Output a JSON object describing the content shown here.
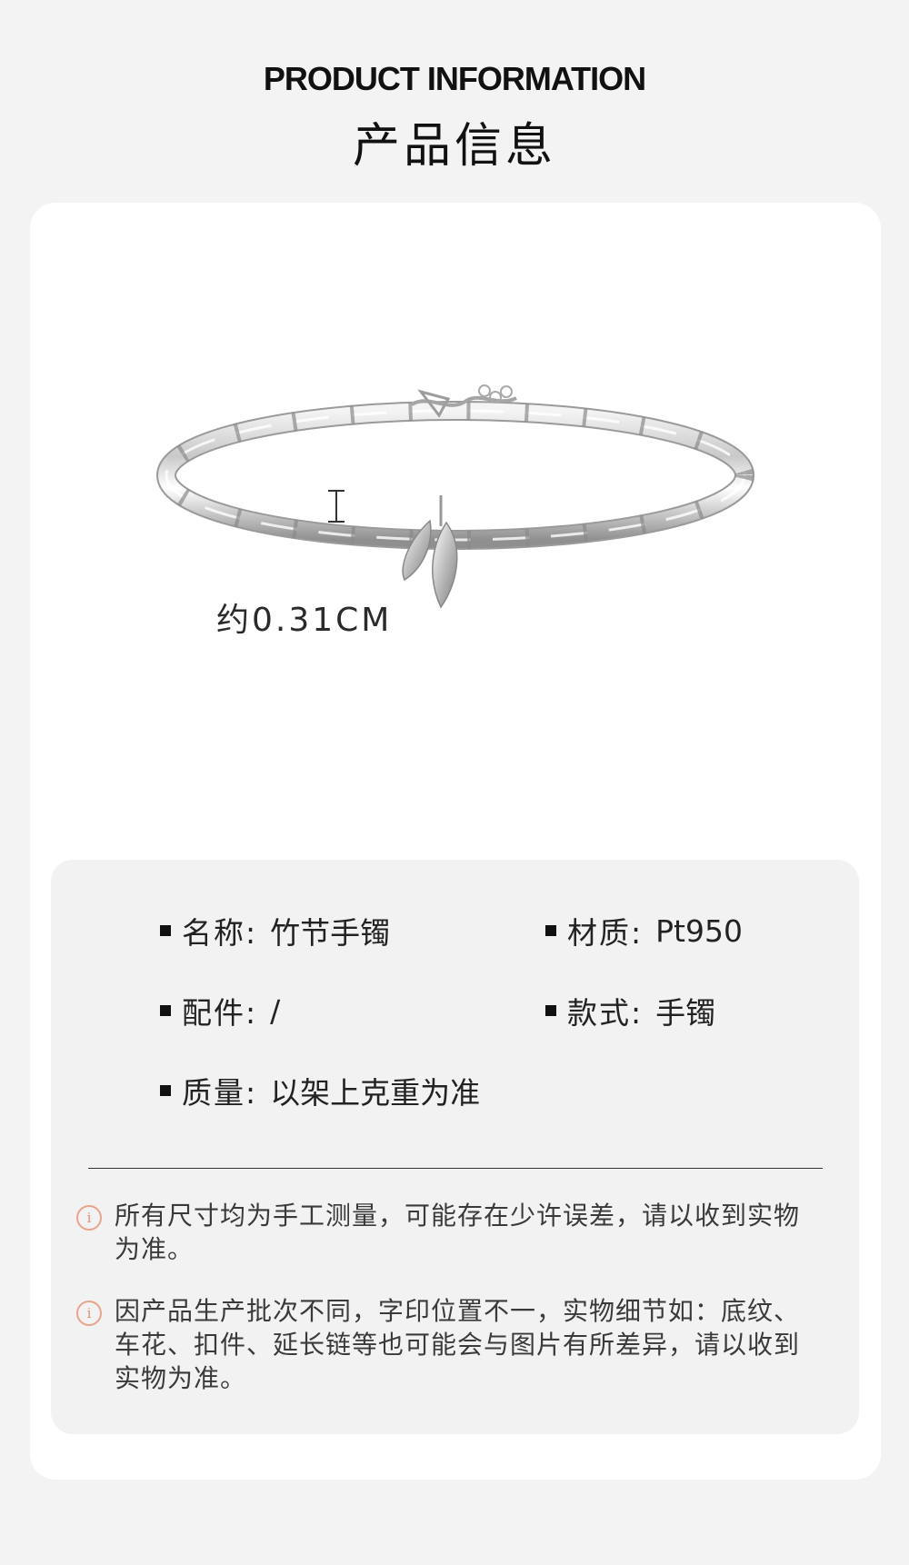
{
  "header": {
    "title_en": "PRODUCT INFORMATION",
    "title_cn": "产品信息"
  },
  "image": {
    "dimension_label": "约0.31CM"
  },
  "specs": {
    "name": {
      "label": "名称:",
      "value": "竹节手镯"
    },
    "material": {
      "label": "材质:",
      "value": "Pt950"
    },
    "accessories": {
      "label": "配件:",
      "value": "/"
    },
    "style": {
      "label": "款式:",
      "value": "手镯"
    },
    "weight": {
      "label": "质量:",
      "value": "以架上克重为准"
    }
  },
  "notes": [
    {
      "icon": "info-icon",
      "text": "所有尺寸均为手工测量，可能存在少许误差，请以收到实物为准。"
    },
    {
      "icon": "info-icon",
      "text": "因产品生产批次不同，字印位置不一，实物细节如：底纹、车花、扣件、延长链等也可能会与图片有所差异，请以收到实物为准。"
    }
  ],
  "colors": {
    "page_background": "#f3f3f3",
    "card_background": "#ffffff",
    "panel_background": "#f2f2f2",
    "accent_icon": "#e0906f"
  }
}
